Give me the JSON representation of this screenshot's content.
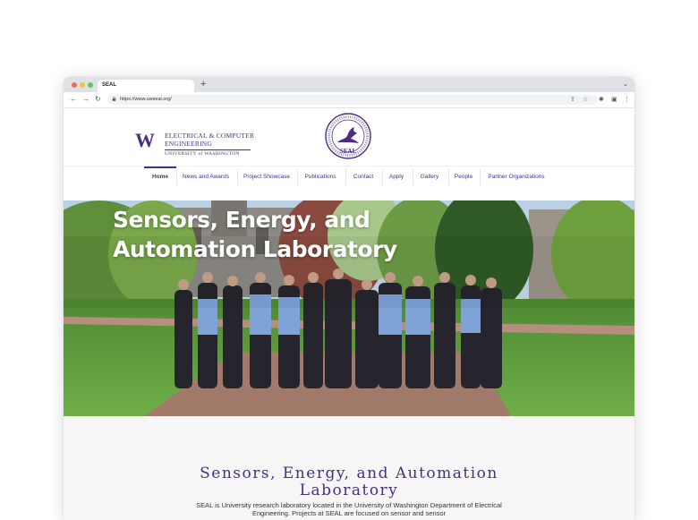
{
  "browser": {
    "tab_title": "SEAL",
    "new_tab": "+",
    "url": "https://www.uwseal.org/"
  },
  "header": {
    "uw_mark": "W",
    "dept_line1": "ELECTRICAL & COMPUTER",
    "dept_line2": "ENGINEERING",
    "university": "UNIVERSITY of WASHINGTON",
    "seal_badge_text": "SEAL"
  },
  "nav": {
    "items": [
      {
        "label": "Home"
      },
      {
        "label": "News and Awards"
      },
      {
        "label": "Project Showcase"
      },
      {
        "label": "Publications"
      },
      {
        "label": "Contact"
      },
      {
        "label": "Apply"
      },
      {
        "label": "Gallery"
      },
      {
        "label": "People"
      },
      {
        "label": "Partner Organizations"
      }
    ],
    "active_index": 0
  },
  "hero": {
    "line1": "Sensors, Energy, and",
    "line2": "Automation Laboratory"
  },
  "intro": {
    "title_line1": "Sensors, Energy, and Automation",
    "title_line2": "Laboratory",
    "text": "SEAL is University research laboratory located in the University of Washington Department of Electrical Engineering. Projects at SEAL are focused on sensor and sensor"
  },
  "colors": {
    "brand_purple": "#4b2e83",
    "hero_grass": "#5f9a3c",
    "hero_path": "#a27a6a"
  },
  "icons": [
    "back-arrow-icon",
    "forward-arrow-icon",
    "reload-icon",
    "lock-icon",
    "share-icon",
    "star-icon",
    "extensions-icon",
    "sidepanel-icon",
    "kebab-menu-icon",
    "chevron-down-icon"
  ]
}
